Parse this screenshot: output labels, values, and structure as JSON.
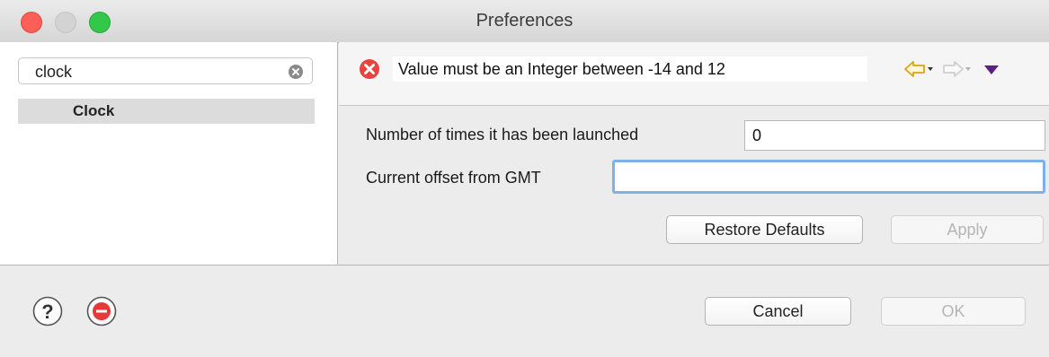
{
  "window": {
    "title": "Preferences"
  },
  "sidebar": {
    "filter": {
      "value": "clock",
      "clear_icon": "clear-search-icon"
    },
    "items": [
      {
        "label": "Clock",
        "selected": true
      }
    ]
  },
  "message": {
    "text": "Value must be an Integer between -14 and 12",
    "icon": "error-icon",
    "nav": {
      "back_icon": "back-arrow-icon",
      "forward_icon": "forward-arrow-icon",
      "menu_icon": "view-menu-icon"
    }
  },
  "form": {
    "launch_count": {
      "label": "Number of times it has been launched",
      "value": "0"
    },
    "gmt_offset": {
      "label": "Current offset from GMT",
      "value": ""
    },
    "restore_label": "Restore Defaults",
    "apply_label": "Apply"
  },
  "footer": {
    "help_icon": "help-icon",
    "record_icon": "record-icon",
    "cancel_label": "Cancel",
    "ok_label": "OK"
  },
  "colors": {
    "error": "#e8433e",
    "focus": "#7fb0ea",
    "nav_arrow": "#e6b422",
    "menu": "#5a1f82"
  }
}
